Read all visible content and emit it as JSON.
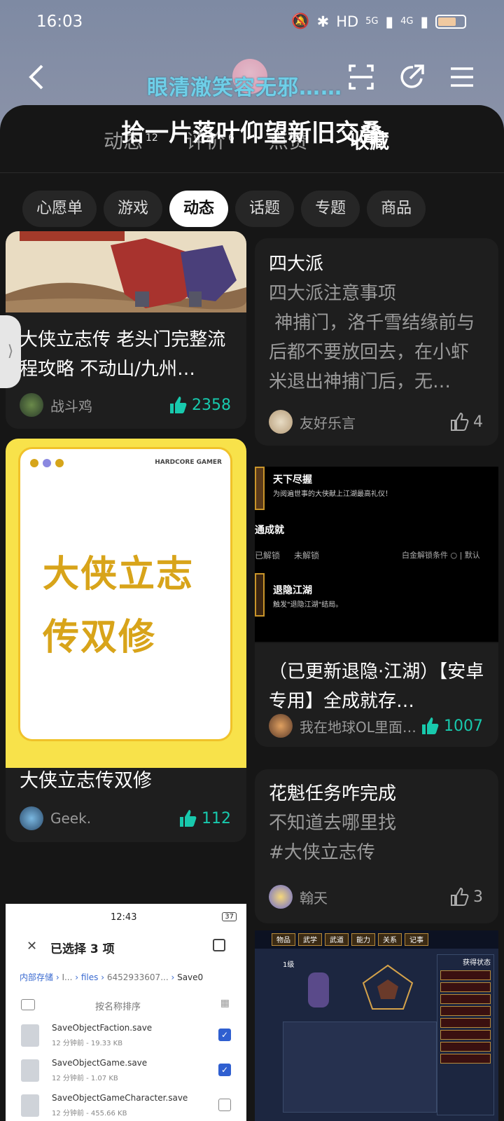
{
  "status": {
    "time": "16:03",
    "network": "HD",
    "sig1": "5G",
    "sig2": "4G"
  },
  "profile": {
    "nickname": "眼清澈笑容无邪……",
    "banner": "拾一片落叶仰望新旧交叠"
  },
  "profile_tabs": [
    {
      "label": "动态",
      "count": "12"
    },
    {
      "label": "评价",
      "count": "6"
    },
    {
      "label": "点赞",
      "count": ""
    },
    {
      "label": "收藏",
      "count": ""
    }
  ],
  "chips": [
    "心愿单",
    "游戏",
    "动态",
    "话题",
    "专题",
    "商品"
  ],
  "cards": {
    "c1": {
      "title": "大侠立志传 老头门完整流程攻略 不动山/九州…",
      "user": "战斗鸡",
      "likes": "2358"
    },
    "c2": {
      "title": "四大派",
      "body": "四大派注意事项\n 神捕门，洛千雪结缘前与后都不要放回去，在小虾米退出神捕门后，无…",
      "user": "友好乐言",
      "likes": "4"
    },
    "c3": {
      "cover_brand": "HARDCORE GAMER",
      "cover_line1": "大侠立志",
      "cover_line2": "传双修",
      "title": "大侠立志传双修",
      "user": "Geek.",
      "likes": "112"
    },
    "c4": {
      "title": "（已更新退隐·江湖）【安卓专用】全成就存…",
      "user": "我在地球OL里面…",
      "likes": "1007"
    },
    "c5": {
      "title": "花魁任务咋完成",
      "body": "不知道去哪里找\n#大侠立志传",
      "user": "翰天",
      "likes": "3"
    }
  },
  "game_shot": {
    "row1_title": "天下尽握",
    "row1_desc": "为阅遍世事的大侠献上江湖最高礼仪！",
    "section": "通成就",
    "tab1": "已解锁",
    "tab2": "未解锁",
    "right_label": "白金解锁条件 ○ | 默认",
    "row2_title": "退隐江湖",
    "row2_desc": "触发\"退隐江湖\"结局。"
  },
  "file_shot": {
    "time": "12:43",
    "battery": "37",
    "header": "已选择 3 项",
    "path": [
      "内部存储",
      "I...",
      "files",
      "6452933607...",
      "Save0"
    ],
    "sort": "按名称排序",
    "files": [
      {
        "name": "SaveObjectFaction.save",
        "meta": "12 分钟前 - 19.33 KB"
      },
      {
        "name": "SaveObjectGame.save",
        "meta": "12 分钟前 - 1.07 KB"
      },
      {
        "name": "SaveObjectGameCharacter.save",
        "meta": "12 分钟前 - 455.66 KB"
      }
    ]
  },
  "game_panel": {
    "tabs": [
      "物品",
      "武学",
      "武道",
      "能力",
      "关系",
      "记事"
    ],
    "level": "1级",
    "right_title": "获得状态"
  },
  "colors": {
    "accent": "#18c9ad",
    "card": "#1e1e1e",
    "panel": "#161616"
  }
}
